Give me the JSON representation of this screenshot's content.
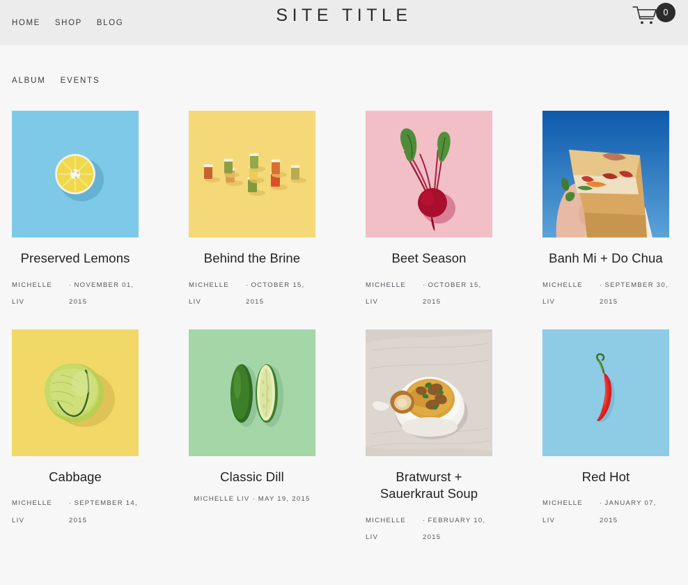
{
  "header": {
    "nav": [
      {
        "label": "HOME",
        "name": "nav-home"
      },
      {
        "label": "SHOP",
        "name": "nav-shop"
      },
      {
        "label": "BLOG",
        "name": "nav-blog"
      }
    ],
    "title": "SITE TITLE",
    "cart": {
      "icon": "shopping-cart-icon",
      "count": "0"
    }
  },
  "tabs": [
    {
      "label": "ALBUM"
    },
    {
      "label": "EVENTS"
    }
  ],
  "posts": [
    {
      "title": "Preserved Lemons",
      "author": "MICHELLE LIV",
      "author_line1": "MICHELLE",
      "author_line2": "LIV",
      "date": "NOVEMBER 01, 2015",
      "date_line1": "NOVEMBER 01,",
      "date_line2": "2015",
      "image_alt": "lemon-half-on-blue",
      "bg_color": "#7ec9e8"
    },
    {
      "title": "Behind the Brine",
      "author": "MICHELLE LIV",
      "author_line1": "MICHELLE",
      "author_line2": "LIV",
      "date": "OCTOBER 15, 2015",
      "date_line1": "OCTOBER 15,",
      "date_line2": "2015",
      "image_alt": "jars-on-yellow",
      "bg_color": "#f5d978"
    },
    {
      "title": "Beet Season",
      "author": "MICHELLE LIV",
      "author_line1": "MICHELLE",
      "author_line2": "LIV",
      "date": "OCTOBER 15, 2015",
      "date_line1": "OCTOBER 15,",
      "date_line2": "2015",
      "image_alt": "beet-on-pink",
      "bg_color": "#f2bfc6"
    },
    {
      "title": "Banh Mi + Do Chua",
      "author": "MICHELLE LIV",
      "author_line1": "MICHELLE",
      "author_line2": "LIV",
      "date": "SEPTEMBER 30, 2015",
      "date_line1": "SEPTEMBER 30,",
      "date_line2": "2015",
      "image_alt": "hand-holding-banh-mi-sky",
      "bg_color": "#1763b0"
    },
    {
      "title": "Cabbage",
      "author": "MICHELLE LIV",
      "author_line1": "MICHELLE",
      "author_line2": "LIV",
      "date": "SEPTEMBER 14, 2015",
      "date_line1": "SEPTEMBER 14,",
      "date_line2": "2015",
      "image_alt": "cabbage-on-yellow",
      "bg_color": "#f2d867"
    },
    {
      "title": "Classic Dill",
      "author": "MICHELLE LIV",
      "date": "MAY 19, 2015",
      "byline": "MICHELLE LIV · MAY 19, 2015",
      "image_alt": "cucumbers-on-green",
      "bg_color": "#a4d6a8"
    },
    {
      "title": "Bratwurst + Sauerkraut Soup",
      "title_line1": "Bratwurst +",
      "title_line2": "Sauerkraut Soup",
      "author": "MICHELLE LIV",
      "author_line1": "MICHELLE",
      "author_line2": "LIV",
      "date": "FEBRUARY 10, 2015",
      "date_line1": "FEBRUARY 10,",
      "date_line2": "2015",
      "image_alt": "soup-bowl-on-linen",
      "bg_color": "#cfc8c2"
    },
    {
      "title": "Red Hot",
      "author": "MICHELLE LIV",
      "author_line1": "MICHELLE",
      "author_line2": "LIV",
      "date": "JANUARY 07, 2015",
      "date_line1": "JANUARY 07,",
      "date_line2": "2015",
      "image_alt": "red-chili-on-blue",
      "bg_color": "#8ecbe5"
    }
  ],
  "colors": {
    "header_bg": "#ececec",
    "page_bg": "#f7f7f7",
    "text": "#2e2e2e",
    "meta_text": "#55555c",
    "badge_bg": "#2c2c2c"
  }
}
